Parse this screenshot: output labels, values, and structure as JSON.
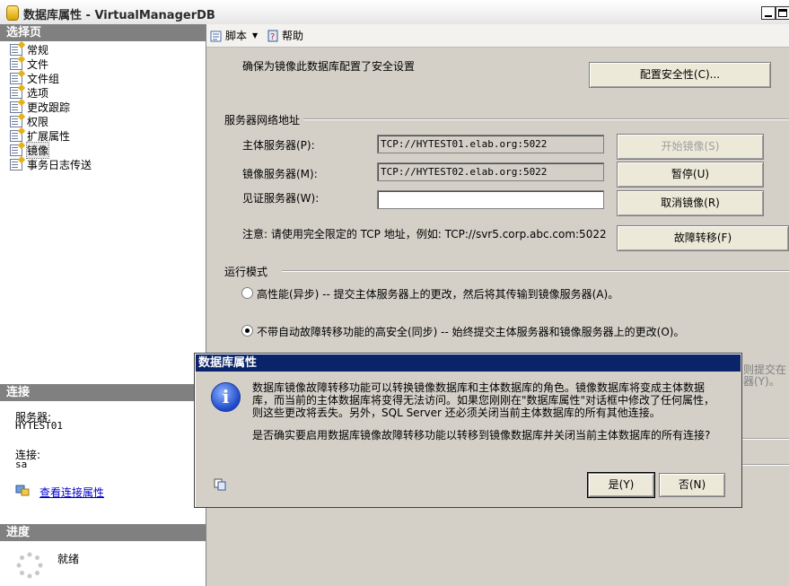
{
  "window": {
    "title": "数据库属性 - VirtualManagerDB"
  },
  "left": {
    "select_page_header": "选择页",
    "nav_items": [
      {
        "label": "常规"
      },
      {
        "label": "文件"
      },
      {
        "label": "文件组"
      },
      {
        "label": "选项"
      },
      {
        "label": "更改跟踪"
      },
      {
        "label": "权限"
      },
      {
        "label": "扩展属性"
      },
      {
        "label": "镜像"
      },
      {
        "label": "事务日志传送"
      }
    ],
    "connection_header": "连接",
    "server_label": "服务器:",
    "server_value": "HYTEST01",
    "connection_label": "连接:",
    "connection_value": "sa",
    "view_connection_link": "查看连接属性",
    "progress_header": "进度",
    "progress_status": "就绪"
  },
  "toolbar": {
    "script_label": "脚本",
    "help_label": "帮助"
  },
  "main": {
    "security_text": "确保为镜像此数据库配置了安全设置",
    "configure_security_button": "配置安全性(C)...",
    "server_network_header": "服务器网络地址",
    "principal_label": "主体服务器(P):",
    "principal_value": "TCP://HYTEST01.elab.org:5022",
    "mirror_label": "镜像服务器(M):",
    "mirror_value": "TCP://HYTEST02.elab.org:5022",
    "witness_label": "见证服务器(W):",
    "witness_value": "",
    "start_mirroring_button": "开始镜像(S)",
    "pause_button": "暂停(U)",
    "remove_mirroring_button": "取消镜像(R)",
    "failover_button": "故障转移(F)",
    "note_text": "注意: 请使用完全限定的 TCP 地址，例如: TCP://svr5.corp.abc.com:5022",
    "operating_mode_header": "运行模式",
    "mode_high_performance": "高性能(异步) -- 提交主体服务器上的更改，然后将其传输到镜像服务器(A)。",
    "mode_high_safety": "不带自动故障转移功能的高安全(同步) -- 始终提交主体服务器和镜像服务器上的更改(O)。",
    "hidden_text_partial_1": "则提交在",
    "hidden_text_partial_2": "器(Y)。"
  },
  "dialog": {
    "title": "数据库属性",
    "message_1": "数据库镜像故障转移功能可以转换镜像数据库和主体数据库的角色。镜像数据库将变成主体数据库，而当前的主体数据库将变得无法访问。如果您刚刚在\"数据库属性\"对话框中修改了任何属性，则这些更改将丢失。另外，SQL Server 还必须关闭当前主体数据库的所有其他连接。",
    "message_2": "是否确实要启用数据库镜像故障转移功能以转移到镜像数据库并关闭当前主体数据库的所有连接?",
    "yes_button": "是(Y)",
    "no_button": "否(N)"
  }
}
